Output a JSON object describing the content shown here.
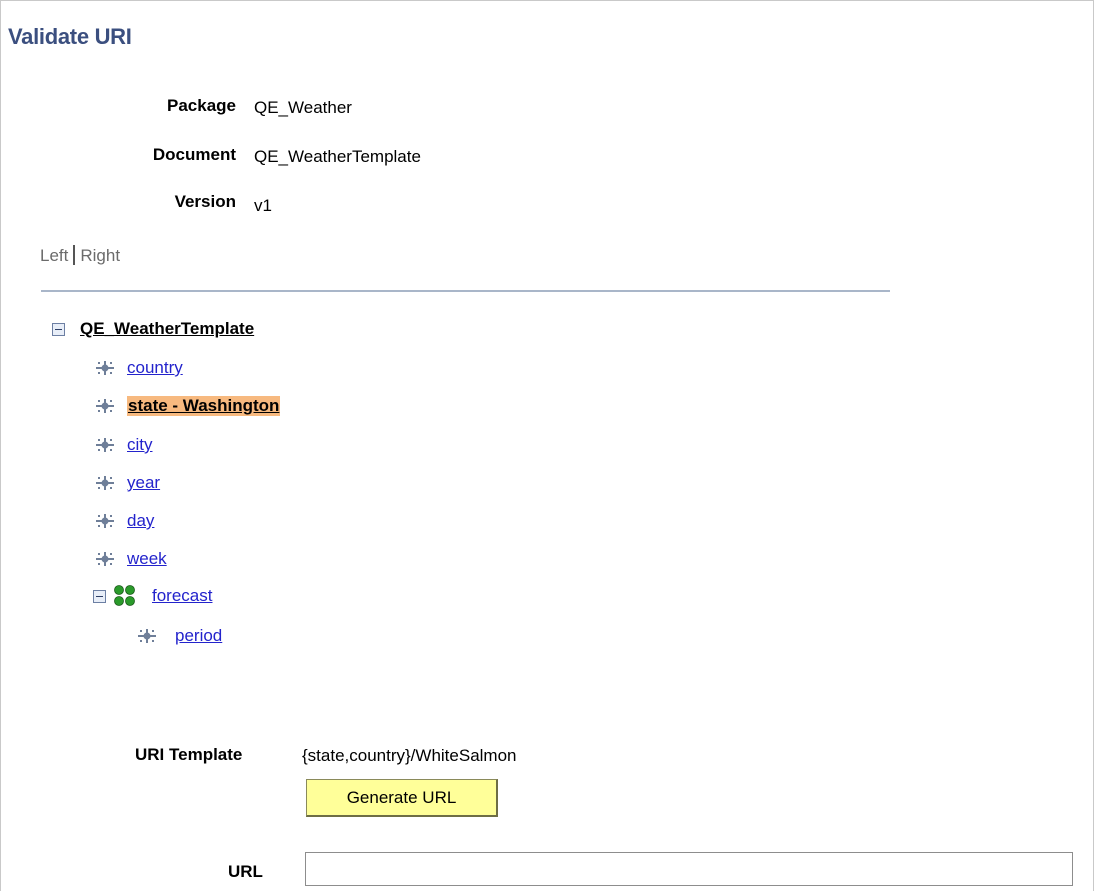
{
  "page": {
    "title": "Validate URI"
  },
  "fields": {
    "package": {
      "label": "Package",
      "value": "QE_Weather"
    },
    "document": {
      "label": "Document",
      "value": "QE_WeatherTemplate"
    },
    "version": {
      "label": "Version",
      "value": "v1"
    }
  },
  "panel_toggle": {
    "left": "Left",
    "right": "Right"
  },
  "tree": {
    "root": "QE_WeatherTemplate",
    "items": [
      {
        "label": "country"
      },
      {
        "label": "state - Washington",
        "selected": true
      },
      {
        "label": "city"
      },
      {
        "label": "year"
      },
      {
        "label": "day"
      },
      {
        "label": "week"
      }
    ],
    "group": {
      "label": "forecast",
      "children": [
        {
          "label": "period"
        }
      ]
    }
  },
  "uri_template": {
    "label": "URI Template",
    "value": "{state,country}/WhiteSalmon"
  },
  "generate_button": {
    "label": "Generate URL"
  },
  "url": {
    "label": "URL",
    "value": "",
    "placeholder": ""
  },
  "colors": {
    "title": "#3b4f7f",
    "link": "#2323cc",
    "selection": "#f7b97f",
    "button": "#ffff99"
  }
}
